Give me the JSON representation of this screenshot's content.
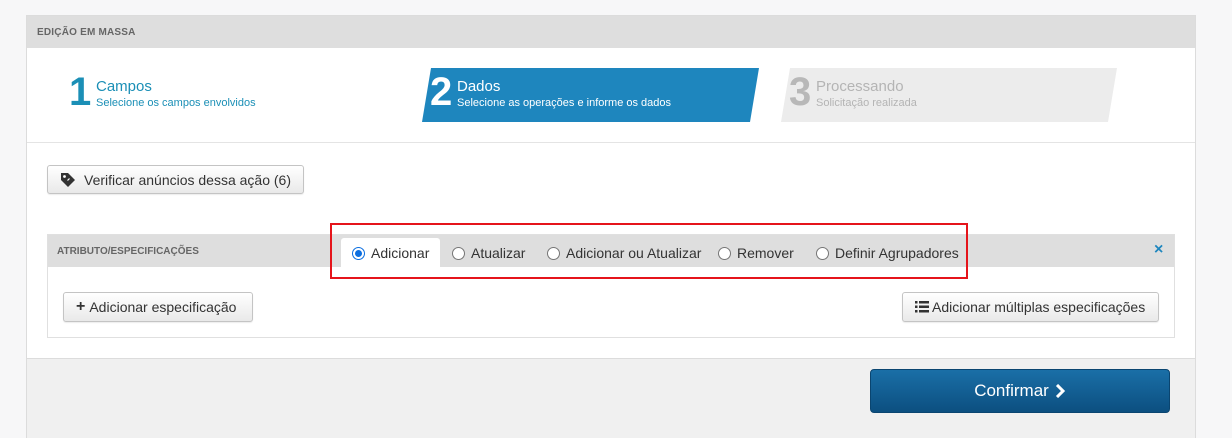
{
  "panel": {
    "title": "EDIÇÃO EM MASSA"
  },
  "steps": [
    {
      "number": "1",
      "title": "Campos",
      "subtitle": "Selecione os campos envolvidos",
      "state": "done"
    },
    {
      "number": "2",
      "title": "Dados",
      "subtitle": "Selecione as operações e informe os dados",
      "state": "active"
    },
    {
      "number": "3",
      "title": "Processando",
      "subtitle": "Solicitação realizada",
      "state": "pending"
    }
  ],
  "verify_button": {
    "label": "Verificar anúncios dessa ação (6)",
    "icon": "tag-icon"
  },
  "attributes": {
    "title": "ATRIBUTO/ESPECIFICAÇÕES",
    "close": "×",
    "operations": [
      {
        "label": "Adicionar",
        "selected": true
      },
      {
        "label": "Atualizar",
        "selected": false
      },
      {
        "label": "Adicionar ou Atualizar",
        "selected": false
      },
      {
        "label": "Remover",
        "selected": false
      },
      {
        "label": "Definir Agrupadores",
        "selected": false
      }
    ],
    "add_spec_label": "Adicionar especificação",
    "add_multi_label": "Adicionar múltiplas especificações"
  },
  "confirm": {
    "label": "Confirmar"
  },
  "colors": {
    "accent": "#1e86be",
    "highlight": "#e5141b",
    "confirm": "#115b90"
  }
}
